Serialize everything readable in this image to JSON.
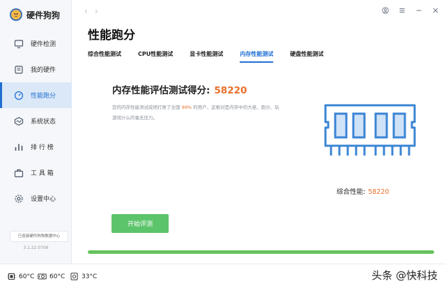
{
  "app": {
    "name": "硬件狗狗"
  },
  "sidebar": {
    "items": [
      {
        "label": "硬件检测",
        "icon": "monitor-icon",
        "active": false
      },
      {
        "label": "我的硬件",
        "icon": "box-icon",
        "active": false
      },
      {
        "label": "性能跑分",
        "icon": "speedometer-icon",
        "active": true
      },
      {
        "label": "系统状态",
        "icon": "system-status-icon",
        "active": false
      },
      {
        "label": "排 行 榜",
        "icon": "ranking-icon",
        "active": false
      },
      {
        "label": "工 具 箱",
        "icon": "toolbox-icon",
        "active": false
      },
      {
        "label": "设置中心",
        "icon": "gear-icon",
        "active": false
      }
    ],
    "db_status": "已连接硬件狗狗数据中心",
    "version": "3.1.22.0706"
  },
  "header": {
    "back_icon": "chevron-left-icon",
    "forward_icon": "chevron-right-icon",
    "controls": [
      "user-icon",
      "menu-icon",
      "minimize-icon",
      "close-icon"
    ]
  },
  "main": {
    "title": "性能跑分",
    "tabs": [
      {
        "label": "综合性能测试",
        "active": false
      },
      {
        "label": "CPU性能测试",
        "active": false
      },
      {
        "label": "显卡性能测试",
        "active": false
      },
      {
        "label": "内存性能测试",
        "active": true
      },
      {
        "label": "硬盘性能测试",
        "active": false
      }
    ],
    "score_label": "内存性能评估测试得分:",
    "score_value": "58220",
    "desc_before": "您的内存性能测试成绩打败了全国",
    "desc_percent": "99%",
    "desc_after": "的用户，这根对是内存中的大佬，跑分、玩游戏什么的毫无压力。",
    "combined_label": "综合性能:",
    "combined_value": "58220",
    "start_button": "开始评测",
    "progress": 1.0,
    "accent_color": "#1f6fd1",
    "score_color": "#e8702a",
    "button_color": "#5cc46b"
  },
  "statusbar": {
    "cpu_temp": "60°C",
    "gpu_temp": "60°C",
    "disk_temp": "33°C",
    "watermark": "头条 @快科技"
  }
}
